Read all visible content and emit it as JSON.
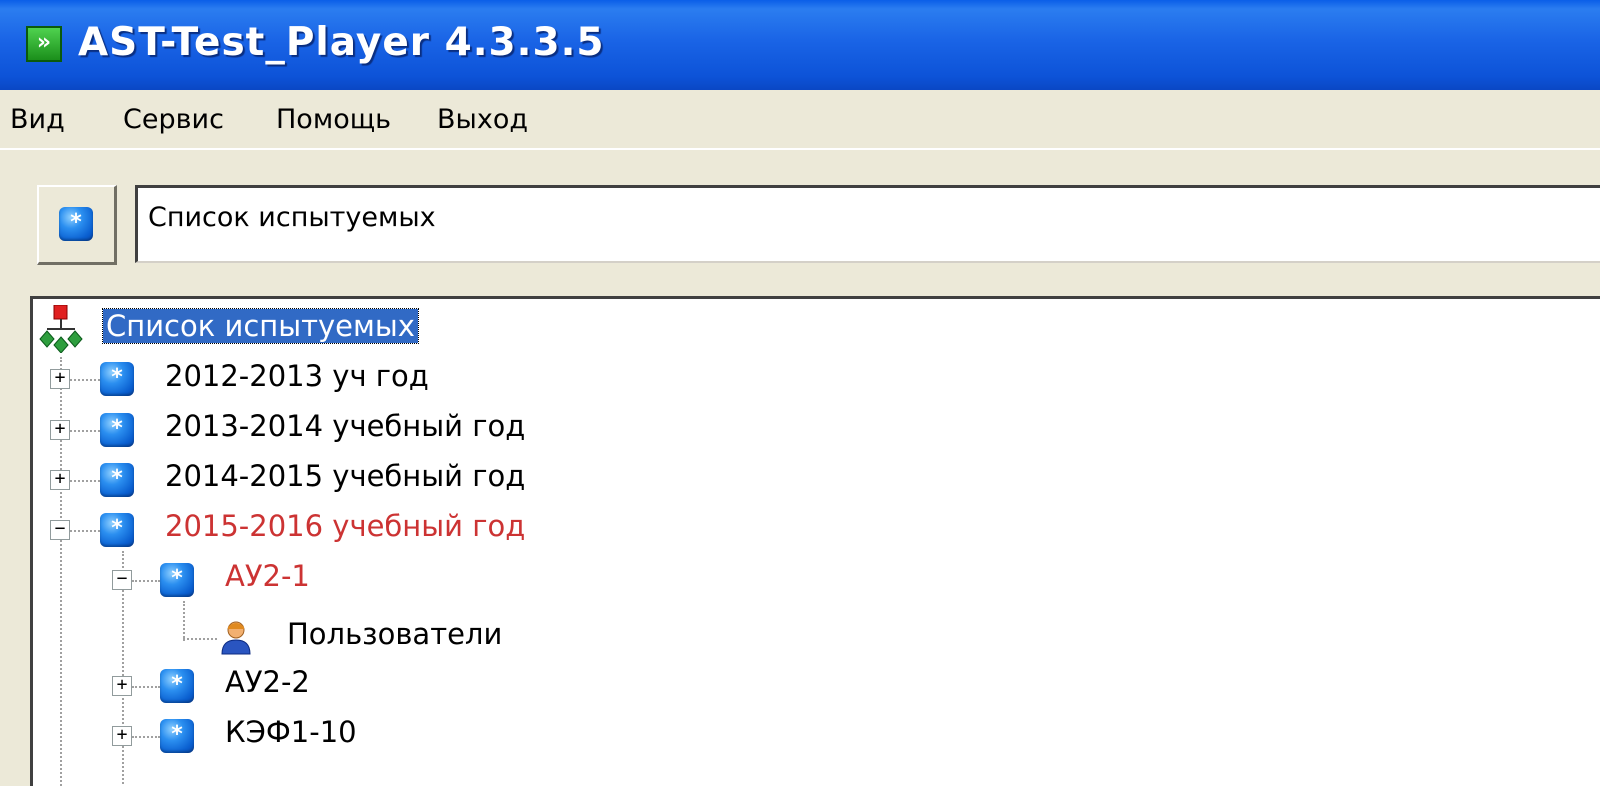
{
  "window": {
    "title": "AST-Test_Player  4.3.3.5",
    "app_icon_glyph": "»"
  },
  "menu": {
    "items": [
      "Вид",
      "Сервис",
      "Помощь",
      "Выход"
    ]
  },
  "toolbar": {
    "path_value": "Список испытуемых",
    "button_icon": "group-icon"
  },
  "tree": {
    "root": {
      "label": "Список испытуемых",
      "icon": "hierarchy-icon",
      "selected": true
    },
    "nodes": [
      {
        "label": "2012-2013 уч год",
        "level": 1,
        "state": "collapsed",
        "highlight": false
      },
      {
        "label": "2013-2014 учебный год",
        "level": 1,
        "state": "collapsed",
        "highlight": false
      },
      {
        "label": "2014-2015 учебный год",
        "level": 1,
        "state": "collapsed",
        "highlight": false
      },
      {
        "label": "2015-2016 учебный год",
        "level": 1,
        "state": "expanded",
        "highlight": true
      },
      {
        "label": "АУ2-1",
        "level": 2,
        "state": "expanded",
        "highlight": true
      },
      {
        "label": "Пользователи",
        "level": 3,
        "state": "leaf",
        "icon": "user-icon"
      },
      {
        "label": "АУ2-2",
        "level": 2,
        "state": "collapsed",
        "highlight": false
      },
      {
        "label": "КЭФ1-10",
        "level": 2,
        "state": "collapsed",
        "highlight": false
      }
    ]
  },
  "colors": {
    "titlebar": "#0a5ee8",
    "highlight_text": "#cc3333",
    "selection": "#316ac5",
    "face": "#ece9d8"
  }
}
